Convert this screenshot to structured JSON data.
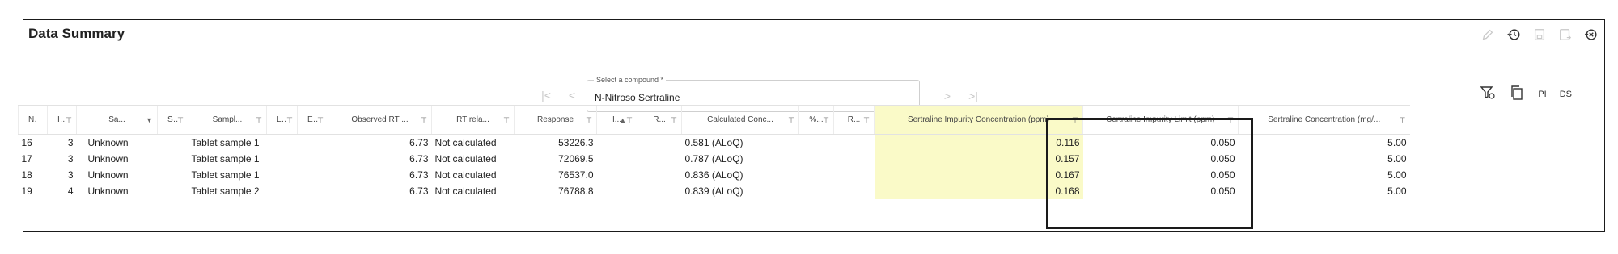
{
  "panel": {
    "title": "Data Summary"
  },
  "compound": {
    "label": "Select a compound *",
    "value": "N-Nitroso Sertraline"
  },
  "toolbar": {
    "pi_label": "PI",
    "ds_label": "DS"
  },
  "table": {
    "headers": [
      "N...",
      "I...",
      "Sa...",
      "S...",
      "Sampl...",
      "L...",
      "E...",
      "Observed RT ...",
      "RT rela...",
      "Response",
      "I...",
      "R...",
      "Calculated Conc...",
      "%...",
      "R...",
      "Sertraline Impurity Concentration (ppm)",
      "Sertraline Impurity Limit (ppm)",
      "Sertraline Concentration (mg/..."
    ],
    "rows": [
      [
        "16",
        "3",
        "Unknown",
        "",
        "Tablet sample 1",
        "",
        "",
        "6.73",
        "Not calculated",
        "53226.3",
        "",
        "",
        "0.581 (ALoQ)",
        "",
        "",
        "0.116",
        "0.050",
        "5.00"
      ],
      [
        "17",
        "3",
        "Unknown",
        "",
        "Tablet sample 1",
        "",
        "",
        "6.73",
        "Not calculated",
        "72069.5",
        "",
        "",
        "0.787 (ALoQ)",
        "",
        "",
        "0.157",
        "0.050",
        "5.00"
      ],
      [
        "18",
        "3",
        "Unknown",
        "",
        "Tablet sample 1",
        "",
        "",
        "6.73",
        "Not calculated",
        "76537.0",
        "",
        "",
        "0.836 (ALoQ)",
        "",
        "",
        "0.167",
        "0.050",
        "5.00"
      ],
      [
        "19",
        "4",
        "Unknown",
        "",
        "Tablet sample 2",
        "",
        "",
        "6.73",
        "Not calculated",
        "76788.8",
        "",
        "",
        "0.839 (ALoQ)",
        "",
        "",
        "0.168",
        "0.050",
        "5.00"
      ]
    ]
  }
}
